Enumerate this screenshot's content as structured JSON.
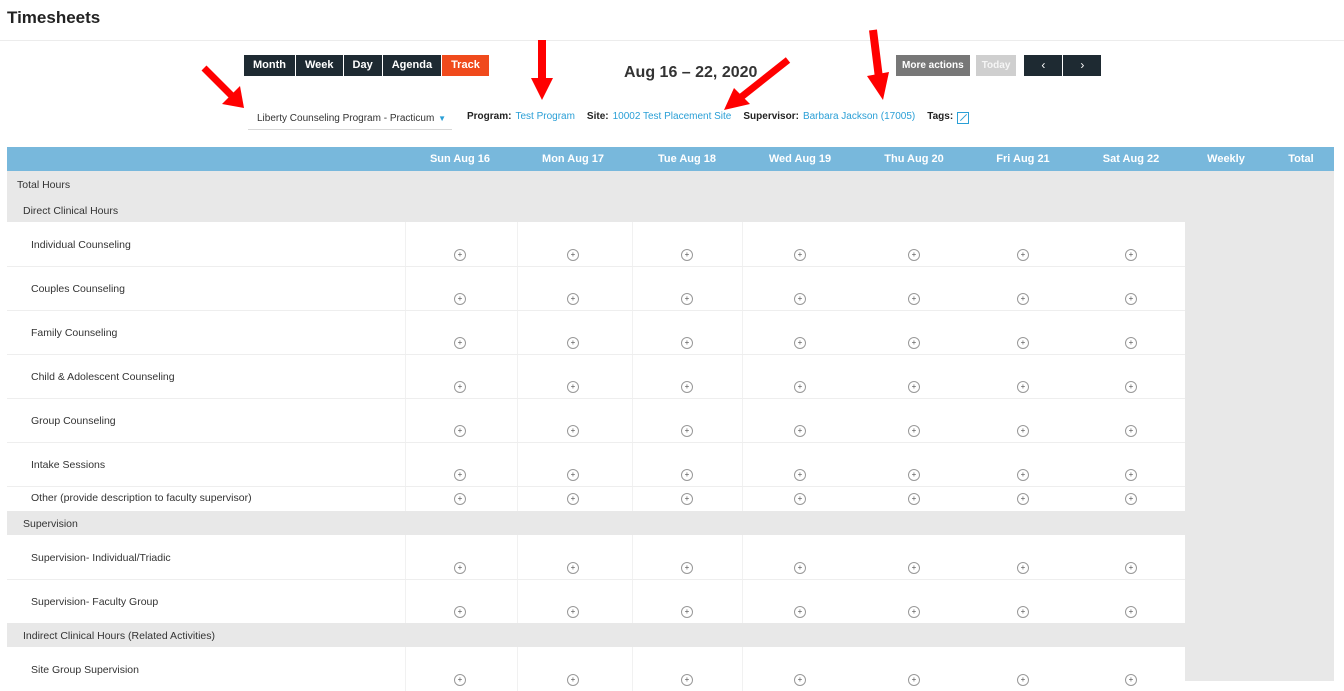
{
  "page": {
    "title": "Timesheets"
  },
  "toolbar": {
    "views": [
      "Month",
      "Week",
      "Day",
      "Agenda",
      "Track"
    ],
    "active_view": "Track",
    "date_range": "Aug 16 – 22, 2020",
    "more_actions": "More actions",
    "today": "Today",
    "prev_icon": "‹",
    "next_icon": "›"
  },
  "filters": {
    "program_select": "Liberty Counseling Program - Practicum",
    "program_label": "Program:",
    "program_value": "Test Program",
    "site_label": "Site:",
    "site_value": "10002 Test Placement Site",
    "supervisor_label": "Supervisor:",
    "supervisor_value": "Barbara Jackson (17005)",
    "tags_label": "Tags:"
  },
  "columns": [
    "Sun Aug 16",
    "Mon Aug 17",
    "Tue Aug 18",
    "Wed Aug 19",
    "Thu Aug 20",
    "Fri Aug 21",
    "Sat Aug 22",
    "Weekly",
    "Total"
  ],
  "total_hours_label": "Total Hours",
  "sections": [
    {
      "label": "Direct Clinical Hours",
      "rows": [
        "Individual Counseling",
        "Couples Counseling",
        "Family Counseling",
        "Child & Adolescent Counseling",
        "Group Counseling",
        "Intake Sessions",
        "Other (provide description to faculty supervisor)"
      ]
    },
    {
      "label": "Supervision",
      "rows": [
        "Supervision- Individual/Triadic",
        "Supervision- Faculty Group"
      ]
    },
    {
      "label": "Indirect Clinical Hours (Related Activities)",
      "rows": [
        "Site Group Supervision"
      ]
    }
  ],
  "colors": {
    "header": "#78b8dc",
    "track": "#f04a1c",
    "dark_button": "#1e2a32",
    "link": "#2a9fd6",
    "arrow": "#ff0000"
  }
}
